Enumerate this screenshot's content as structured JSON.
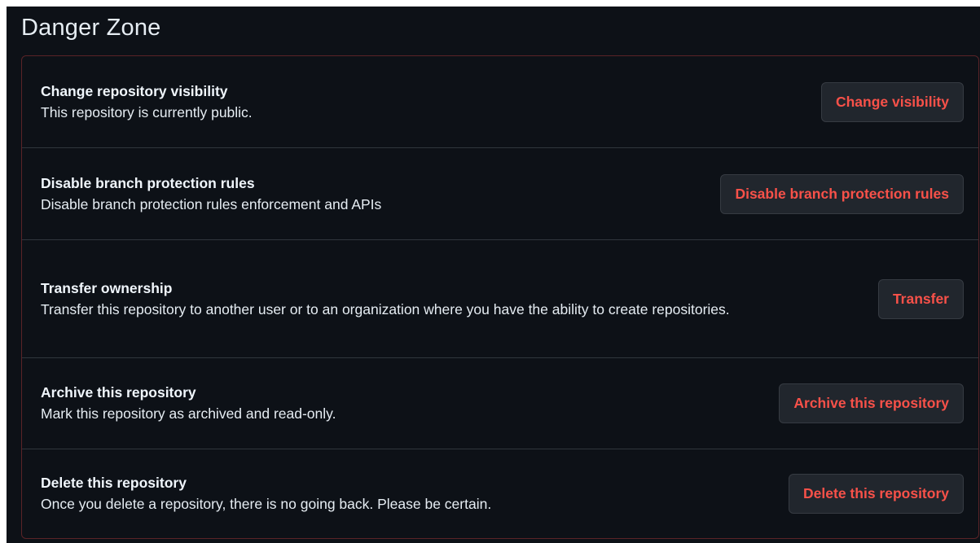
{
  "section": {
    "title": "Danger Zone"
  },
  "rows": [
    {
      "title": "Change repository visibility",
      "description": "This repository is currently public.",
      "button": "Change visibility"
    },
    {
      "title": "Disable branch protection rules",
      "description": "Disable branch protection rules enforcement and APIs",
      "button": "Disable branch protection rules"
    },
    {
      "title": "Transfer ownership",
      "description": "Transfer this repository to another user or to an organization where you have the ability to create repositories.",
      "button": "Transfer"
    },
    {
      "title": "Archive this repository",
      "description": "Mark this repository as archived and read-only.",
      "button": "Archive this repository"
    },
    {
      "title": "Delete this repository",
      "description": "Once you delete a repository, there is no going back. Please be certain.",
      "button": "Delete this repository"
    }
  ],
  "colors": {
    "background": "#0d1117",
    "danger_border": "#5a2327",
    "divider": "#30363d",
    "button_background": "#21262d",
    "danger_text": "#f85149"
  }
}
